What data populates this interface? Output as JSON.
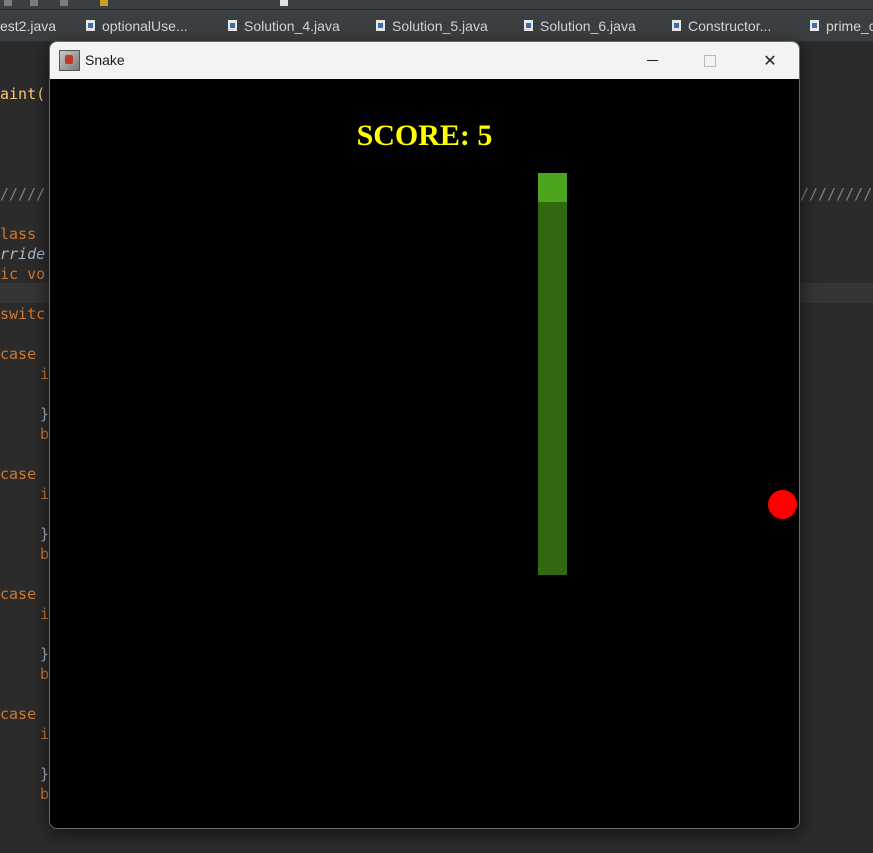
{
  "ide": {
    "tabs": [
      {
        "label": "est2.java"
      },
      {
        "label": "optionalUse..."
      },
      {
        "label": "Solution_4.java"
      },
      {
        "label": "Solution_5.java"
      },
      {
        "label": "Solution_6.java"
      },
      {
        "label": "Constructor..."
      },
      {
        "label": "prime_c"
      }
    ],
    "code_lines": {
      "paint": "aint(",
      "sep_left": "/////",
      "sep_right": "////////",
      "class_kw": "lass",
      "override": "rride",
      "void_kw": "ic vo",
      "switch_kw": "switc",
      "case_kw": "case",
      "stmt_i": "i",
      "brace": "}",
      "stmt_b": "b"
    }
  },
  "window": {
    "title": "Snake",
    "controls": {
      "minimize": "minimize",
      "maximize": "maximize",
      "close": "✕"
    }
  },
  "game": {
    "score_label": "SCORE: 5",
    "score": 5,
    "colors": {
      "background": "#000000",
      "score_text": "#ffff00",
      "snake_head": "#4da51e",
      "snake_body": "#326810",
      "apple": "#ff0000"
    }
  }
}
